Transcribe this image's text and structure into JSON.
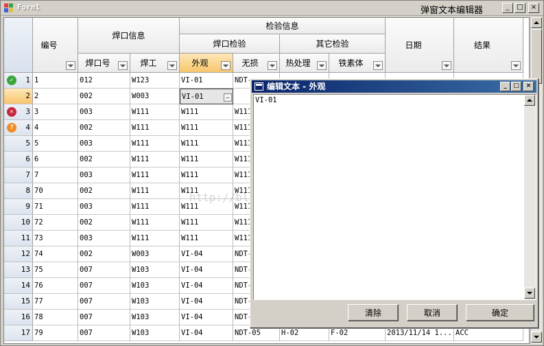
{
  "window": {
    "title_left": "Form1",
    "title_center": "弹窗文本编辑器",
    "caption": {
      "minimize": "_",
      "maximize": "□",
      "close": "×"
    }
  },
  "grid": {
    "group_headers": {
      "weld_info": "焊口信息",
      "inspect_info": "检验信息",
      "weld_inspect": "焊口检验",
      "other_inspect": "其它检验"
    },
    "columns": {
      "number": "编号",
      "weld_no": "焊口号",
      "welder": "焊工",
      "appearance": "外观",
      "ndt": "无损",
      "heat": "热处理",
      "ferrite": "铁素体",
      "date": "日期",
      "result": "结果"
    },
    "rows": [
      {
        "idx": "1",
        "icon": "check",
        "no": "1",
        "weld": "012",
        "welder": "W123",
        "look": "VI-01",
        "ndt": "NDT-",
        "heat": "",
        "fe": "",
        "date": "",
        "res": ""
      },
      {
        "idx": "2",
        "icon": "",
        "no": "2",
        "weld": "002",
        "welder": "W003",
        "look": "VI-01",
        "ndt": "",
        "heat": "",
        "fe": "",
        "date": "",
        "res": ""
      },
      {
        "idx": "3",
        "icon": "error",
        "no": "3",
        "weld": "003",
        "welder": "W111",
        "look": "W111",
        "ndt": "W111",
        "heat": "",
        "fe": "",
        "date": "",
        "res": ""
      },
      {
        "idx": "4",
        "icon": "help",
        "no": "4",
        "weld": "002",
        "welder": "W111",
        "look": "W111",
        "ndt": "W111",
        "heat": "",
        "fe": "",
        "date": "",
        "res": ""
      },
      {
        "idx": "5",
        "icon": "",
        "no": "5",
        "weld": "003",
        "welder": "W111",
        "look": "W111",
        "ndt": "W111",
        "heat": "",
        "fe": "",
        "date": "",
        "res": ""
      },
      {
        "idx": "6",
        "icon": "",
        "no": "6",
        "weld": "002",
        "welder": "W111",
        "look": "W111",
        "ndt": "W111",
        "heat": "",
        "fe": "",
        "date": "",
        "res": ""
      },
      {
        "idx": "7",
        "icon": "",
        "no": "7",
        "weld": "003",
        "welder": "W111",
        "look": "W111",
        "ndt": "W111",
        "heat": "",
        "fe": "",
        "date": "",
        "res": ""
      },
      {
        "idx": "8",
        "icon": "",
        "no": "70",
        "weld": "002",
        "welder": "W111",
        "look": "W111",
        "ndt": "W111",
        "heat": "",
        "fe": "",
        "date": "",
        "res": ""
      },
      {
        "idx": "9",
        "icon": "",
        "no": "71",
        "weld": "003",
        "welder": "W111",
        "look": "W111",
        "ndt": "W111",
        "heat": "",
        "fe": "",
        "date": "",
        "res": ""
      },
      {
        "idx": "10",
        "icon": "",
        "no": "72",
        "weld": "002",
        "welder": "W111",
        "look": "W111",
        "ndt": "W111",
        "heat": "",
        "fe": "",
        "date": "",
        "res": ""
      },
      {
        "idx": "11",
        "icon": "",
        "no": "73",
        "weld": "003",
        "welder": "W111",
        "look": "W111",
        "ndt": "W111",
        "heat": "",
        "fe": "",
        "date": "",
        "res": ""
      },
      {
        "idx": "12",
        "icon": "",
        "no": "74",
        "weld": "002",
        "welder": "W003",
        "look": "VI-04",
        "ndt": "NDT-",
        "heat": "",
        "fe": "",
        "date": "",
        "res": ""
      },
      {
        "idx": "13",
        "icon": "",
        "no": "75",
        "weld": "007",
        "welder": "W103",
        "look": "VI-04",
        "ndt": "NDT-",
        "heat": "",
        "fe": "",
        "date": "",
        "res": ""
      },
      {
        "idx": "14",
        "icon": "",
        "no": "76",
        "weld": "007",
        "welder": "W103",
        "look": "VI-04",
        "ndt": "NDT-",
        "heat": "",
        "fe": "",
        "date": "",
        "res": ""
      },
      {
        "idx": "15",
        "icon": "",
        "no": "77",
        "weld": "007",
        "welder": "W103",
        "look": "VI-04",
        "ndt": "NDT-",
        "heat": "",
        "fe": "",
        "date": "",
        "res": ""
      },
      {
        "idx": "16",
        "icon": "",
        "no": "78",
        "weld": "007",
        "welder": "W103",
        "look": "VI-04",
        "ndt": "NDT-",
        "heat": "",
        "fe": "",
        "date": "",
        "res": ""
      },
      {
        "idx": "17",
        "icon": "",
        "no": "79",
        "weld": "007",
        "welder": "W103",
        "look": "VI-04",
        "ndt": "NDT-05",
        "heat": "H-02",
        "fe": "F-02",
        "date": "2013/11/14 1...",
        "res": "ACC"
      }
    ]
  },
  "watermark": "http://blog.csdn.net/ljfblog",
  "dialog": {
    "title": "编辑文本 - 外观",
    "text": "VI-01",
    "buttons": {
      "clear": "清除",
      "cancel": "取消",
      "ok": "确定"
    }
  },
  "icons": {
    "app": "form-app-icon",
    "check": "check-icon",
    "error": "error-icon",
    "help": "help-icon"
  },
  "colors": {
    "selected_header": "#f8c66d",
    "dialog_title": "#0a246a",
    "check": "#3aa63a",
    "error": "#c8283c",
    "help": "#f08c28"
  }
}
